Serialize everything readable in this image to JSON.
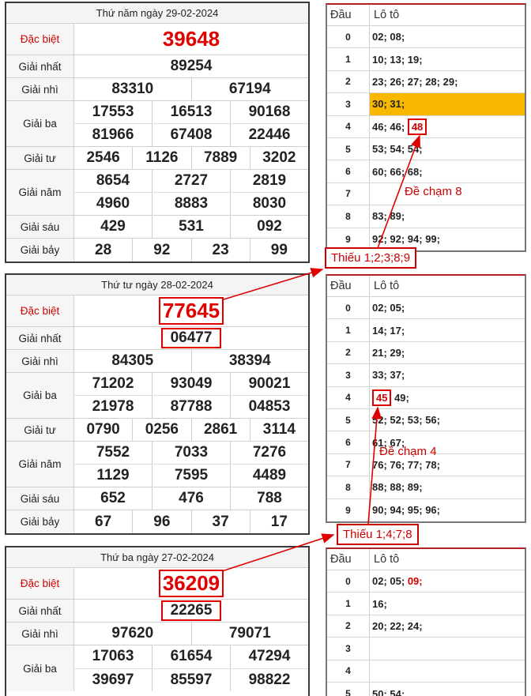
{
  "labels": {
    "special": "Đặc biệt",
    "first": "Giải nhất",
    "second": "Giải nhì",
    "third": "Giải ba",
    "fourth": "Giải tư",
    "fifth": "Giải năm",
    "sixth": "Giải sáu",
    "seventh": "Giải bảy",
    "head_col": "Đầu",
    "loto_col": "Lô tô"
  },
  "results": [
    {
      "date": "Thứ năm ngày 29-02-2024",
      "special": "39648",
      "first": "89254",
      "second": [
        "83310",
        "67194"
      ],
      "third": [
        "17553",
        "16513",
        "90168",
        "81966",
        "67408",
        "22446"
      ],
      "fourth": [
        "2546",
        "1126",
        "7889",
        "3202"
      ],
      "fifth": [
        "8654",
        "2727",
        "2819",
        "4960",
        "8883",
        "8030"
      ],
      "sixth": [
        "429",
        "531",
        "092"
      ],
      "seventh": [
        "28",
        "92",
        "23",
        "99"
      ]
    },
    {
      "date": "Thứ tư ngày 28-02-2024",
      "special": "77645",
      "first": "06477",
      "second": [
        "84305",
        "38394"
      ],
      "third": [
        "71202",
        "93049",
        "90021",
        "21978",
        "87788",
        "04853"
      ],
      "fourth": [
        "0790",
        "0256",
        "2861",
        "3114"
      ],
      "fifth": [
        "7552",
        "7033",
        "7276",
        "1129",
        "7595",
        "4489"
      ],
      "sixth": [
        "652",
        "476",
        "788"
      ],
      "seventh": [
        "67",
        "96",
        "37",
        "17"
      ]
    },
    {
      "date": "Thứ ba ngày 27-02-2024",
      "special": "36209",
      "first": "22265",
      "second": [
        "97620",
        "79071"
      ],
      "third": [
        "17063",
        "61654",
        "47294",
        "39697",
        "85597",
        "98822"
      ]
    }
  ],
  "loto": [
    {
      "rows": [
        {
          "head": "0",
          "text": "02; 08;"
        },
        {
          "head": "1",
          "text": "10; 13; 19;"
        },
        {
          "head": "2",
          "text": "23; 26; 27; 28; 29;"
        },
        {
          "head": "3",
          "text": "30; 31;"
        },
        {
          "head": "4",
          "text": "46; 46; ",
          "boxed": "48"
        },
        {
          "head": "5",
          "text": "53; 54; 54;"
        },
        {
          "head": "6",
          "text": "60; 66; 68;"
        },
        {
          "head": "7",
          "text": ""
        },
        {
          "head": "8",
          "text": "83; 89;"
        },
        {
          "head": "9",
          "text": "92; 92; 94; 99;"
        }
      ],
      "note": "Đề chạm 8",
      "missing": "Thiếu 1;2;3;8;9"
    },
    {
      "rows": [
        {
          "head": "0",
          "text": "02; 05;"
        },
        {
          "head": "1",
          "text": "14; 17;"
        },
        {
          "head": "2",
          "text": "21; 29;"
        },
        {
          "head": "3",
          "text": "33; 37;"
        },
        {
          "head": "4",
          "boxed": "45",
          "text": " 49;"
        },
        {
          "head": "5",
          "text": "52; 52; 53; 56;"
        },
        {
          "head": "6",
          "text": "61; 67;"
        },
        {
          "head": "7",
          "text": "76; 76; 77; 78;"
        },
        {
          "head": "8",
          "text": "88; 88; 89;"
        },
        {
          "head": "9",
          "text": "90; 94; 95; 96;"
        }
      ],
      "note": "Đề chạm 4",
      "missing": "Thiếu 1;4;7;8"
    },
    {
      "rows": [
        {
          "head": "0",
          "text": "02; 05; ",
          "red": "09;"
        },
        {
          "head": "1",
          "text": "16;"
        },
        {
          "head": "2",
          "text": "20; 22; 24;"
        },
        {
          "head": "3",
          "text": ""
        },
        {
          "head": "4",
          "text": ""
        },
        {
          "head": "5",
          "text": "50; 54;"
        }
      ]
    }
  ],
  "colors": {
    "accent_red": "#e00000",
    "highlight_row": "#f8b800",
    "border_dark": "#3a3a3a"
  }
}
